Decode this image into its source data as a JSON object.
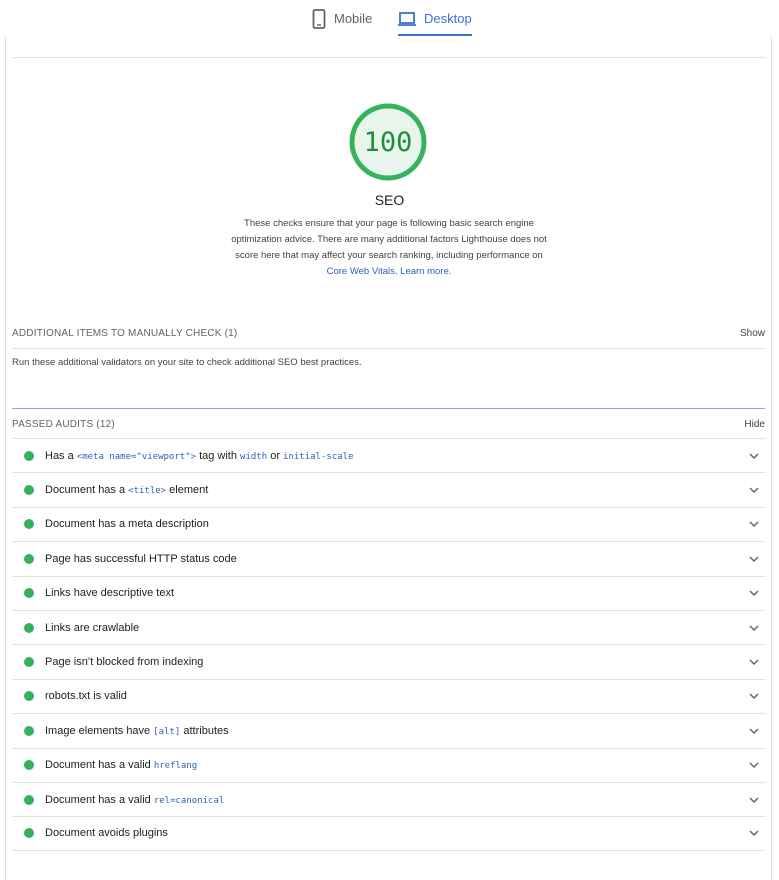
{
  "tabs": [
    {
      "label": "Mobile",
      "icon": "phone-icon",
      "active": false
    },
    {
      "label": "Desktop",
      "icon": "laptop-icon",
      "active": true
    }
  ],
  "category": {
    "score": "100",
    "title": "SEO",
    "description_text": "These checks ensure that your page is following basic search engine optimization advice. There are many additional factors Lighthouse does not score here that may affect your search ranking, including performance on ",
    "link_core_web_vitals": "Core Web Vitals",
    "link_sep": ". ",
    "link_learn_more": "Learn more.",
    "gauge_color": "#34b35a"
  },
  "manual": {
    "heading": "ADDITIONAL ITEMS TO MANUALLY CHECK",
    "count": "(1)",
    "toggle": "Show",
    "description": "Run these additional validators on your site to check additional SEO best practices."
  },
  "passed": {
    "heading": "PASSED AUDITS",
    "count": "(12)",
    "toggle": "Hide",
    "audits": [
      {
        "parts": [
          {
            "t": "Has a "
          },
          {
            "c": "<meta name=\"viewport\">"
          },
          {
            "t": " tag with "
          },
          {
            "c": "width"
          },
          {
            "t": " or "
          },
          {
            "c": "initial-scale"
          }
        ]
      },
      {
        "parts": [
          {
            "t": "Document has a "
          },
          {
            "c": "<title>"
          },
          {
            "t": " element"
          }
        ]
      },
      {
        "parts": [
          {
            "t": "Document has a meta description"
          }
        ]
      },
      {
        "parts": [
          {
            "t": "Page has successful HTTP status code"
          }
        ]
      },
      {
        "parts": [
          {
            "t": "Links have descriptive text"
          }
        ]
      },
      {
        "parts": [
          {
            "t": "Links are crawlable"
          }
        ]
      },
      {
        "parts": [
          {
            "t": "Page isn’t blocked from indexing"
          }
        ]
      },
      {
        "parts": [
          {
            "t": "robots.txt is valid"
          }
        ]
      },
      {
        "parts": [
          {
            "t": "Image elements have "
          },
          {
            "c": "[alt]"
          },
          {
            "t": " attributes"
          }
        ]
      },
      {
        "parts": [
          {
            "t": "Document has a valid "
          },
          {
            "c": "hreflang"
          }
        ]
      },
      {
        "parts": [
          {
            "t": "Document has a valid "
          },
          {
            "c": "rel=canonical"
          }
        ]
      },
      {
        "parts": [
          {
            "t": "Document avoids plugins"
          }
        ]
      }
    ]
  },
  "colors": {
    "pass": "#34b35a",
    "accent": "#3c6fd1",
    "link": "#2f5fbd"
  }
}
